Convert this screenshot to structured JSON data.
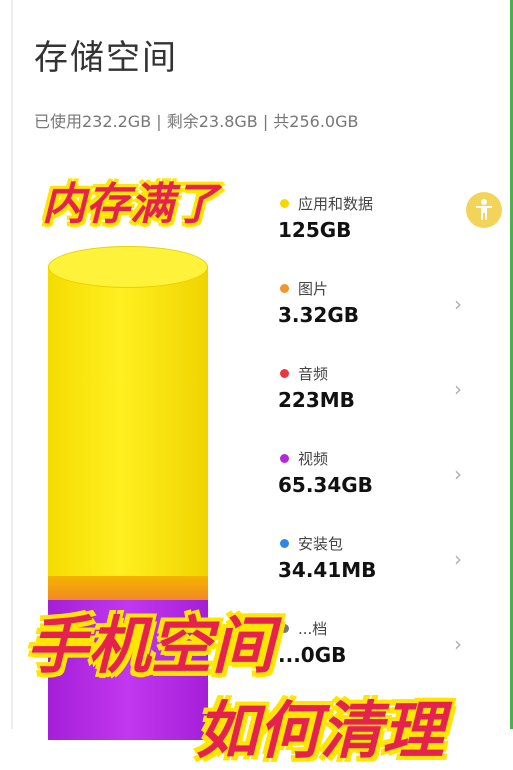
{
  "page": {
    "title": "存储空间",
    "summary": "已使用232.2GB | 剩余23.8GB | 共256.0GB"
  },
  "colors": {
    "apps": "#f5d800",
    "images": "#f0962e",
    "audio": "#e8383d",
    "video": "#b22ad6",
    "packages": "#2f86e8",
    "overlay_text": "#e4214f",
    "overlay_outline": "#ffe600"
  },
  "storage": {
    "items": [
      {
        "label": "应用和数据",
        "size": "125GB",
        "color": "#f5d800"
      },
      {
        "label": "图片",
        "size": "3.32GB",
        "color": "#f0962e"
      },
      {
        "label": "音频",
        "size": "223MB",
        "color": "#e8383d"
      },
      {
        "label": "视频",
        "size": "65.34GB",
        "color": "#b22ad6"
      },
      {
        "label": "安装包",
        "size": "34.41MB",
        "color": "#2f86e8"
      },
      {
        "label": "...档",
        "size": "...0GB",
        "color": "#777777"
      }
    ],
    "chevron": "›"
  },
  "overlay": {
    "line1": "内存满了",
    "line2": "手机空间",
    "line3": "如何清理"
  },
  "icons": {
    "floating": "accessibility-person-icon",
    "chevron": "chevron-right-icon"
  }
}
